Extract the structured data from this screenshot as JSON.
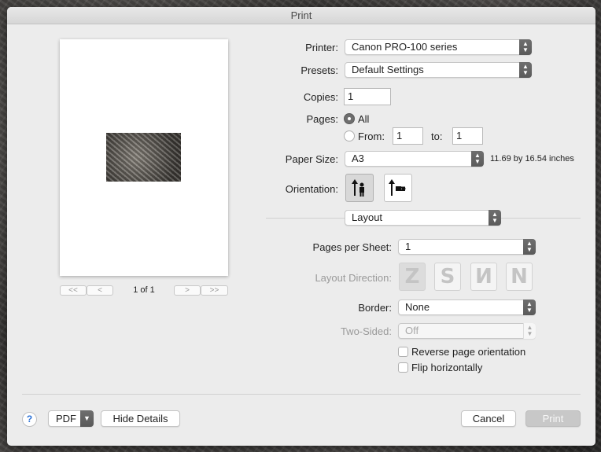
{
  "window": {
    "title": "Print"
  },
  "preview": {
    "page_indicator": "1 of 1",
    "first_label": "<<",
    "prev_label": "<",
    "next_label": ">",
    "last_label": ">>"
  },
  "printer": {
    "label": "Printer:",
    "value": "Canon PRO-100 series"
  },
  "presets": {
    "label": "Presets:",
    "value": "Default Settings"
  },
  "copies": {
    "label": "Copies:",
    "value": "1"
  },
  "pages": {
    "label": "Pages:",
    "all_label": "All",
    "from_label": "From:",
    "to_label": "to:",
    "from_value": "1",
    "to_value": "1",
    "selected": "All"
  },
  "paper": {
    "label": "Paper Size:",
    "value": "A3",
    "dimensions": "11.69 by 16.54 inches"
  },
  "orientation": {
    "label": "Orientation:",
    "selected": "portrait"
  },
  "section": {
    "value": "Layout"
  },
  "layout": {
    "pages_per_sheet_label": "Pages per Sheet:",
    "pages_per_sheet_value": "1",
    "direction_label": "Layout Direction:",
    "directions": [
      "Z",
      "S",
      "И",
      "N"
    ],
    "border_label": "Border:",
    "border_value": "None",
    "two_sided_label": "Two-Sided:",
    "two_sided_value": "Off",
    "reverse_label": "Reverse page orientation",
    "flip_label": "Flip horizontally"
  },
  "footer": {
    "help": "?",
    "pdf": "PDF",
    "hide_details": "Hide Details",
    "cancel": "Cancel",
    "print": "Print"
  }
}
